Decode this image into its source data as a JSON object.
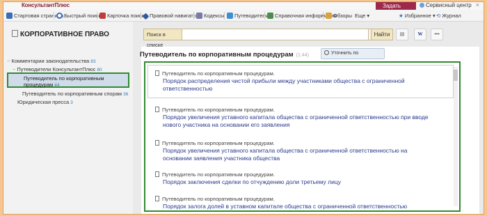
{
  "app": {
    "brand": "КонсультантПлюс",
    "ask_label": "Задать вопрос",
    "service_label": "Сервисный центр"
  },
  "toolbar": {
    "items": [
      {
        "label": "Стартовая страница",
        "icon": "home-icon"
      },
      {
        "label": "Быстрый поиск",
        "icon": "search-icon"
      },
      {
        "label": "Карточка поиска",
        "icon": "card-icon"
      },
      {
        "label": "Правовой навигатор",
        "icon": "navigator-icon"
      },
      {
        "label": "Кодексы",
        "icon": "codes-icon"
      },
      {
        "label": "Путеводители",
        "icon": "guides-icon"
      },
      {
        "label": "Справочная информация",
        "icon": "reference-icon"
      },
      {
        "label": "Обзоры",
        "icon": "reviews-icon"
      },
      {
        "label": "Еще",
        "icon": "chevron-down-icon"
      }
    ],
    "favorites_label": "Избранное",
    "journal_label": "Журнал"
  },
  "left": {
    "title": "КОРПОРАТИВНОЕ ПРАВО",
    "tree": [
      {
        "label": "Комментарии законодательства",
        "count": "83"
      },
      {
        "label": "Путеводители КонсультантПлюс",
        "count": "80"
      },
      {
        "label_line1": "Путеводитель по корпоративным",
        "label_line2": "процедурам",
        "count": "44"
      },
      {
        "label": "Путеводитель по корпоративным спорам",
        "count": "36"
      },
      {
        "label": "Юридическая пресса",
        "count": "3"
      }
    ]
  },
  "search": {
    "label": "Поиск в списке",
    "value": "",
    "button": "Найти"
  },
  "content": {
    "title": "Путеводитель по корпоративным процедурам",
    "time": "(1:44)",
    "refine_label": "Уточнить по реквизитам"
  },
  "docs": [
    {
      "source": "Путеводитель по корпоративным процедурам.",
      "line1": "Порядок распределения чистой прибыли между участниками общества с ограниченной",
      "line2": "ответственностью"
    },
    {
      "source": "Путеводитель по корпоративным процедурам.",
      "line1": "Порядок увеличения уставного капитала общества с ограниченной ответственностью при вводе",
      "line2": "нового участника на основании его заявления"
    },
    {
      "source": "Путеводитель по корпоративным процедурам.",
      "line1": "Порядок увеличения уставного капитала общества с ограниченной ответственностью на",
      "line2": "основании заявления участника общества"
    },
    {
      "source": "Путеводитель по корпоративным процедурам.",
      "line1": "Порядок заключения сделки по отчуждению доли третьему лицу",
      "line2": ""
    },
    {
      "source": "Путеводитель по корпоративным процедурам.",
      "line1": "Порядок залога долей в уставном капитале общества с ограниченной ответственностью",
      "line2": ""
    }
  ],
  "colors": {
    "accent_green": "#2f8a2f",
    "link_blue": "#2b3a8c",
    "brand": "#8b1d2c",
    "background": "#f6c690"
  }
}
